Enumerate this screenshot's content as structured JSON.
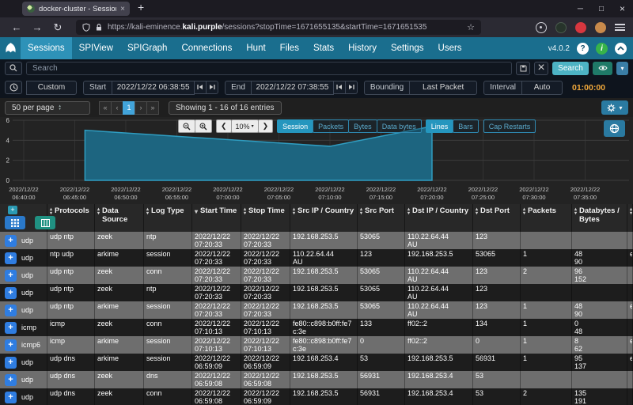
{
  "colors": {
    "navbar": "#1a6e8e",
    "navbar_active": "#2e92b8",
    "search_button": "#4db3c4",
    "eye_button": "#1f7a68",
    "accent_blue": "#2596be",
    "duration_amber": "#f2a93b",
    "page_active": "#42a4da",
    "row_alt": "#6e6e6e",
    "row_dark": "#1d1d1d",
    "expand_button": "#2f7de1",
    "chart_fill": "#1d6580",
    "chart_line": "#2f9dc1"
  },
  "browser": {
    "tab": {
      "title": "docker-cluster - Sessions",
      "close": "×"
    },
    "new_tab_button": "+",
    "window": {
      "minimize": "─",
      "maximize": "□",
      "close": "×"
    },
    "url": {
      "prefix": "https://kali-eminence.",
      "host": "kali.purple",
      "path": "/sessions?stopTime=1671655135&startTime=1671651535"
    }
  },
  "nav": {
    "items": [
      {
        "label": "Sessions",
        "active": true
      },
      {
        "label": "SPIView"
      },
      {
        "label": "SPIGraph"
      },
      {
        "label": "Connections"
      },
      {
        "label": "Hunt"
      },
      {
        "label": "Files"
      },
      {
        "label": "Stats"
      },
      {
        "label": "History"
      },
      {
        "label": "Settings"
      },
      {
        "label": "Users"
      }
    ],
    "version": "v4.0.2"
  },
  "search": {
    "placeholder": "Search",
    "button_label": "Search"
  },
  "timebar": {
    "preset": "Custom",
    "start_label": "Start",
    "start": "2022/12/22 06:38:55",
    "end_label": "End",
    "end": "2022/12/22 07:38:55",
    "bounding_label": "Bounding",
    "bounding": "Last Packet",
    "interval_label": "Interval",
    "interval": "Auto",
    "duration": "01:00:00"
  },
  "pagination": {
    "per_page": "50 per page",
    "buttons": [
      {
        "label": "«",
        "name": "first"
      },
      {
        "label": "‹",
        "name": "prev"
      },
      {
        "label": "1",
        "name": "page-1",
        "active": true
      },
      {
        "label": "›",
        "name": "next"
      },
      {
        "label": "»",
        "name": "last"
      }
    ],
    "summary": "Showing 1 - 16 of 16 entries"
  },
  "graph": {
    "zoom_level": "10%",
    "metrics": [
      {
        "label": "Session",
        "active": true
      },
      {
        "label": "Packets"
      },
      {
        "label": "Bytes"
      },
      {
        "label": "Data bytes"
      }
    ],
    "styles": [
      {
        "label": "Lines",
        "active": true
      },
      {
        "label": "Bars"
      }
    ],
    "cap_restarts": "Cap Restarts"
  },
  "chart_data": {
    "type": "area",
    "series": [
      {
        "name": "Session",
        "points": [
          {
            "time": "06:46:00",
            "value": 5.0
          },
          {
            "time": "07:10:00",
            "value": 3.4
          },
          {
            "time": "07:20:00",
            "value": 5.4
          }
        ]
      }
    ],
    "x_start": "06:38:55",
    "x_end": "07:38:55",
    "x_tick_date": "2022/12/22",
    "x_ticks": [
      "06:40:00",
      "06:45:00",
      "06:50:00",
      "06:55:00",
      "07:00:00",
      "07:05:00",
      "07:10:00",
      "07:15:00",
      "07:20:00",
      "07:25:00",
      "07:30:00",
      "07:35:00"
    ],
    "ylim": [
      0,
      6
    ],
    "y_ticks": [
      6,
      4,
      2,
      0
    ],
    "grid": true,
    "legend": "none"
  },
  "table": {
    "columns": [
      {
        "key": "protocols",
        "label": "Protocols",
        "sort": "both"
      },
      {
        "key": "data-source",
        "label": "Data Source",
        "sort": "both"
      },
      {
        "key": "log-type",
        "label": "Log Type",
        "sort": "both"
      },
      {
        "key": "start-time",
        "label": "Start Time",
        "sort": "desc"
      },
      {
        "key": "stop-time",
        "label": "Stop Time",
        "sort": "both"
      },
      {
        "key": "src-ip",
        "label": "Src IP / Country",
        "sort": "both"
      },
      {
        "key": "src-port",
        "label": "Src Port",
        "sort": "both"
      },
      {
        "key": "dst-ip",
        "label": "Dst IP / Country",
        "sort": "both"
      },
      {
        "key": "dst-port",
        "label": "Dst Port",
        "sort": "both"
      },
      {
        "key": "packets",
        "label": "Packets",
        "sort": "both"
      },
      {
        "key": "databytes",
        "label": "Databytes / Bytes",
        "sort": "both"
      }
    ],
    "rows": [
      {
        "proto": "udp",
        "protocols": "udp  ntp",
        "source": "zeek",
        "log_type": "ntp",
        "start": "2022/12/22 07:20:33",
        "stop": "2022/12/22 07:20:33",
        "src_ip": "192.168.253.5",
        "src_cc": "",
        "src_port": "53065",
        "dst_ip": "110.22.64.44",
        "dst_cc": "AU",
        "dst_port": "123",
        "packets": "",
        "databytes": "",
        "bytes": "",
        "node": ""
      },
      {
        "proto": "udp",
        "protocols": "ntp  udp",
        "source": "arkime",
        "log_type": "session",
        "start": "2022/12/22 07:20:33",
        "stop": "2022/12/22 07:20:33",
        "src_ip": "110.22.64.44",
        "src_cc": "AU",
        "src_port": "123",
        "dst_ip": "192.168.253.5",
        "dst_cc": "",
        "dst_port": "53065",
        "packets": "1",
        "databytes": "48",
        "bytes": "90",
        "node": "e"
      },
      {
        "proto": "udp",
        "protocols": "udp  ntp",
        "source": "zeek",
        "log_type": "conn",
        "start": "2022/12/22 07:20:33",
        "stop": "2022/12/22 07:20:33",
        "src_ip": "192.168.253.5",
        "src_cc": "",
        "src_port": "53065",
        "dst_ip": "110.22.64.44",
        "dst_cc": "AU",
        "dst_port": "123",
        "packets": "2",
        "databytes": "96",
        "bytes": "152",
        "node": ""
      },
      {
        "proto": "udp",
        "protocols": "udp  ntp",
        "source": "zeek",
        "log_type": "ntp",
        "start": "2022/12/22 07:20:33",
        "stop": "2022/12/22 07:20:33",
        "src_ip": "192.168.253.5",
        "src_cc": "",
        "src_port": "53065",
        "dst_ip": "110.22.64.44",
        "dst_cc": "AU",
        "dst_port": "123",
        "packets": "",
        "databytes": "",
        "bytes": "",
        "node": ""
      },
      {
        "proto": "udp",
        "protocols": "udp  ntp",
        "source": "arkime",
        "log_type": "session",
        "start": "2022/12/22 07:20:33",
        "stop": "2022/12/22 07:20:33",
        "src_ip": "192.168.253.5",
        "src_cc": "",
        "src_port": "53065",
        "dst_ip": "110.22.64.44",
        "dst_cc": "AU",
        "dst_port": "123",
        "packets": "1",
        "databytes": "48",
        "bytes": "90",
        "node": "e"
      },
      {
        "proto": "icmp",
        "protocols": "icmp",
        "source": "zeek",
        "log_type": "conn",
        "start": "2022/12/22 07:10:13",
        "stop": "2022/12/22 07:10:13",
        "src_ip": "fe80::c898:b0ff:fe7c:3e",
        "src_cc": "",
        "src_port": "133",
        "dst_ip": "ff02::2",
        "dst_cc": "",
        "dst_port": "134",
        "packets": "1",
        "databytes": "0",
        "bytes": "48",
        "node": ""
      },
      {
        "proto": "icmp6",
        "protocols": "icmp",
        "source": "arkime",
        "log_type": "session",
        "start": "2022/12/22 07:10:13",
        "stop": "2022/12/22 07:10:13",
        "src_ip": "fe80::c898:b0ff:fe7c:3e",
        "src_cc": "",
        "src_port": "0",
        "dst_ip": "ff02::2",
        "dst_cc": "",
        "dst_port": "0",
        "packets": "1",
        "databytes": "8",
        "bytes": "62",
        "node": "e"
      },
      {
        "proto": "udp",
        "protocols": "udp  dns",
        "source": "arkime",
        "log_type": "session",
        "start": "2022/12/22 06:59:09",
        "stop": "2022/12/22 06:59:09",
        "src_ip": "192.168.253.4",
        "src_cc": "",
        "src_port": "53",
        "dst_ip": "192.168.253.5",
        "dst_cc": "",
        "dst_port": "56931",
        "packets": "1",
        "databytes": "95",
        "bytes": "137",
        "node": "e"
      },
      {
        "proto": "udp",
        "protocols": "udp  dns",
        "source": "zeek",
        "log_type": "dns",
        "start": "2022/12/22 06:59:08",
        "stop": "2022/12/22 06:59:08",
        "src_ip": "192.168.253.5",
        "src_cc": "",
        "src_port": "56931",
        "dst_ip": "192.168.253.4",
        "dst_cc": "",
        "dst_port": "53",
        "packets": "",
        "databytes": "",
        "bytes": "",
        "node": ""
      },
      {
        "proto": "udp",
        "protocols": "udp  dns",
        "source": "zeek",
        "log_type": "conn",
        "start": "2022/12/22 06:59:08",
        "stop": "2022/12/22 06:59:09",
        "src_ip": "192.168.253.5",
        "src_cc": "",
        "src_port": "56931",
        "dst_ip": "192.168.253.4",
        "dst_cc": "",
        "dst_port": "53",
        "packets": "2",
        "databytes": "135",
        "bytes": "191",
        "node": ""
      }
    ]
  }
}
